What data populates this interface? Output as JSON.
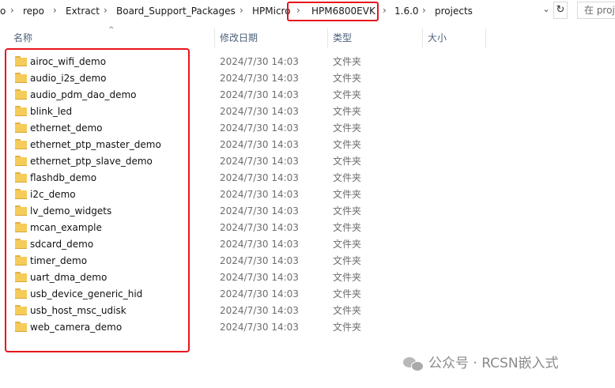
{
  "address": {
    "crumbs": [
      "o",
      "repo",
      "Extract",
      "Board_Support_Packages",
      "HPMicro",
      "HPM6800EVK",
      "1.6.0",
      "projects"
    ],
    "separator": "›",
    "dropdown_glyph": "⌄",
    "refresh_glyph": "↻",
    "search_placeholder": "在 proj"
  },
  "columns": {
    "name": "名称",
    "date": "修改日期",
    "type": "类型",
    "size": "大小",
    "sort_glyph": "^"
  },
  "rows": [
    {
      "name": "airoc_wifi_demo",
      "date": "2024/7/30 14:03",
      "type": "文件夹"
    },
    {
      "name": "audio_i2s_demo",
      "date": "2024/7/30 14:03",
      "type": "文件夹"
    },
    {
      "name": "audio_pdm_dao_demo",
      "date": "2024/7/30 14:03",
      "type": "文件夹"
    },
    {
      "name": "blink_led",
      "date": "2024/7/30 14:03",
      "type": "文件夹"
    },
    {
      "name": "ethernet_demo",
      "date": "2024/7/30 14:03",
      "type": "文件夹"
    },
    {
      "name": "ethernet_ptp_master_demo",
      "date": "2024/7/30 14:03",
      "type": "文件夹"
    },
    {
      "name": "ethernet_ptp_slave_demo",
      "date": "2024/7/30 14:03",
      "type": "文件夹"
    },
    {
      "name": "flashdb_demo",
      "date": "2024/7/30 14:03",
      "type": "文件夹"
    },
    {
      "name": "i2c_demo",
      "date": "2024/7/30 14:03",
      "type": "文件夹"
    },
    {
      "name": "lv_demo_widgets",
      "date": "2024/7/30 14:03",
      "type": "文件夹"
    },
    {
      "name": "mcan_example",
      "date": "2024/7/30 14:03",
      "type": "文件夹"
    },
    {
      "name": "sdcard_demo",
      "date": "2024/7/30 14:03",
      "type": "文件夹"
    },
    {
      "name": "timer_demo",
      "date": "2024/7/30 14:03",
      "type": "文件夹"
    },
    {
      "name": "uart_dma_demo",
      "date": "2024/7/30 14:03",
      "type": "文件夹"
    },
    {
      "name": "usb_device_generic_hid",
      "date": "2024/7/30 14:03",
      "type": "文件夹"
    },
    {
      "name": "usb_host_msc_udisk",
      "date": "2024/7/30 14:03",
      "type": "文件夹"
    },
    {
      "name": "web_camera_demo",
      "date": "2024/7/30 14:03",
      "type": "文件夹"
    }
  ],
  "watermark": {
    "text": "公众号 · RCSN嵌入式",
    "icon": "wechat-icon"
  },
  "colors": {
    "highlight": "#e8141b",
    "folder": "#f5cc5a",
    "header_text": "#4c607a"
  }
}
